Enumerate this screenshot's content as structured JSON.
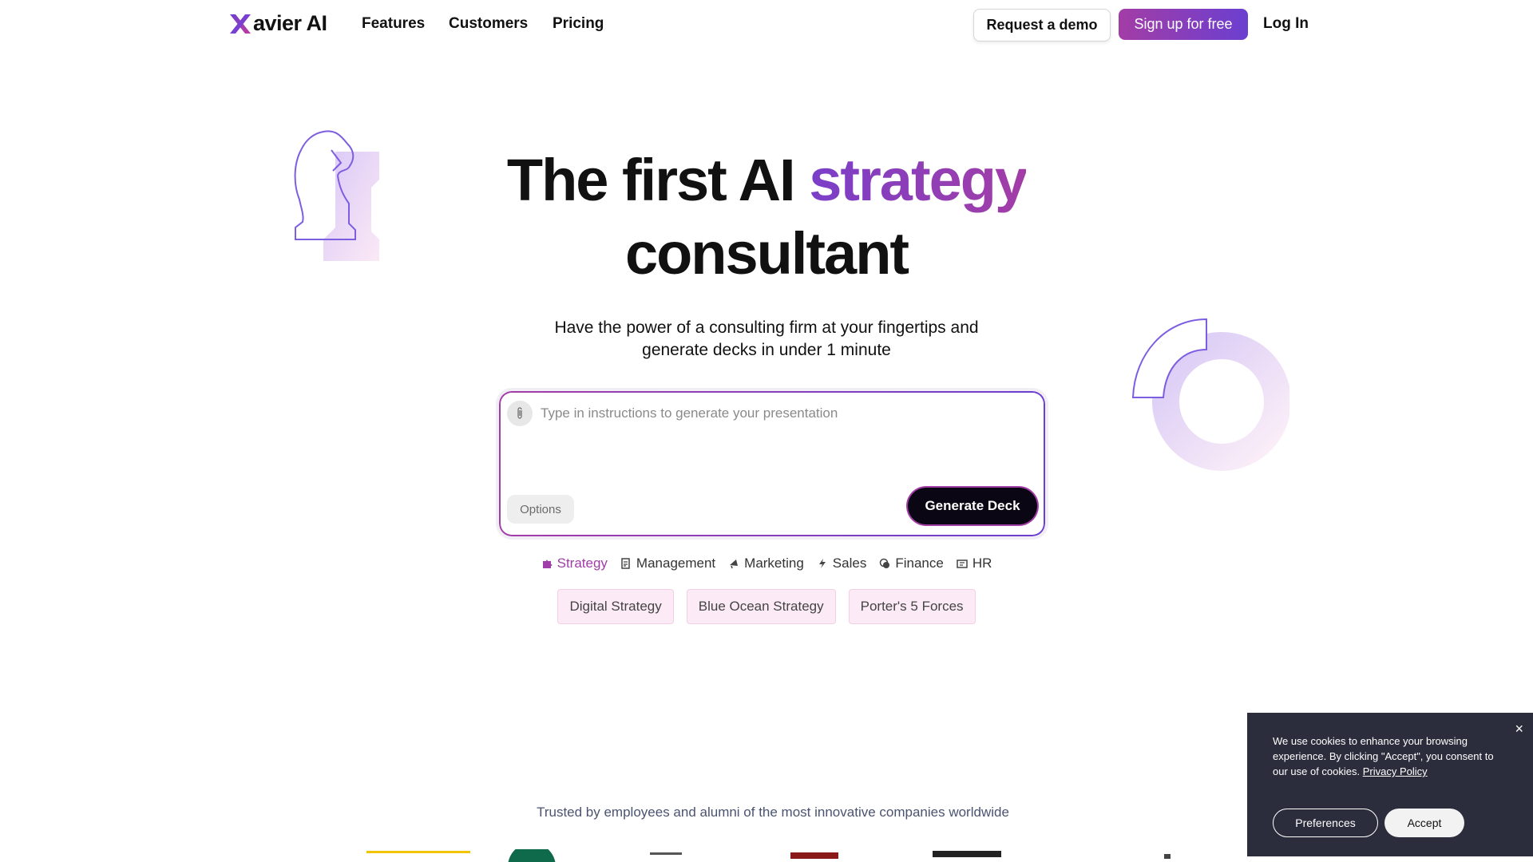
{
  "nav": {
    "logo_text": "avier AI",
    "links": [
      "Features",
      "Customers",
      "Pricing"
    ],
    "request_demo": "Request a demo",
    "signup": "Sign up for free",
    "login": "Log In"
  },
  "hero": {
    "title_part1": "The first AI ",
    "title_accent": "strategy",
    "title_part2": "consultant",
    "subtitle_line1": "Have the power of a consulting firm at your fingertips and",
    "subtitle_line2": "generate decks in under 1 minute"
  },
  "prompt": {
    "placeholder": "Type in instructions to generate your presentation",
    "value": "",
    "options_label": "Options",
    "generate_label": "Generate Deck"
  },
  "categories": [
    {
      "label": "Strategy",
      "icon": "puzzle-icon",
      "active": true
    },
    {
      "label": "Management",
      "icon": "document-icon",
      "active": false
    },
    {
      "label": "Marketing",
      "icon": "megaphone-icon",
      "active": false
    },
    {
      "label": "Sales",
      "icon": "lightning-icon",
      "active": false
    },
    {
      "label": "Finance",
      "icon": "coins-icon",
      "active": false
    },
    {
      "label": "HR",
      "icon": "people-icon",
      "active": false
    }
  ],
  "suggestions": [
    "Digital Strategy",
    "Blue Ocean Strategy",
    "Porter's 5 Forces"
  ],
  "trusted_text": "Trusted by employees and alumni of the most innovative companies worldwide",
  "cookie": {
    "text": "We use cookies to enhance your browsing experience. By clicking \"Accept\", you consent to our use of cookies. ",
    "policy_link": "Privacy Policy",
    "preferences": "Preferences",
    "accept": "Accept",
    "close_symbol": "×"
  },
  "colors": {
    "accent_purple": "#a33da6",
    "accent_violet": "#6b3fd0",
    "dark": "#0b0613",
    "cookie_bg": "#2b2d3c"
  }
}
